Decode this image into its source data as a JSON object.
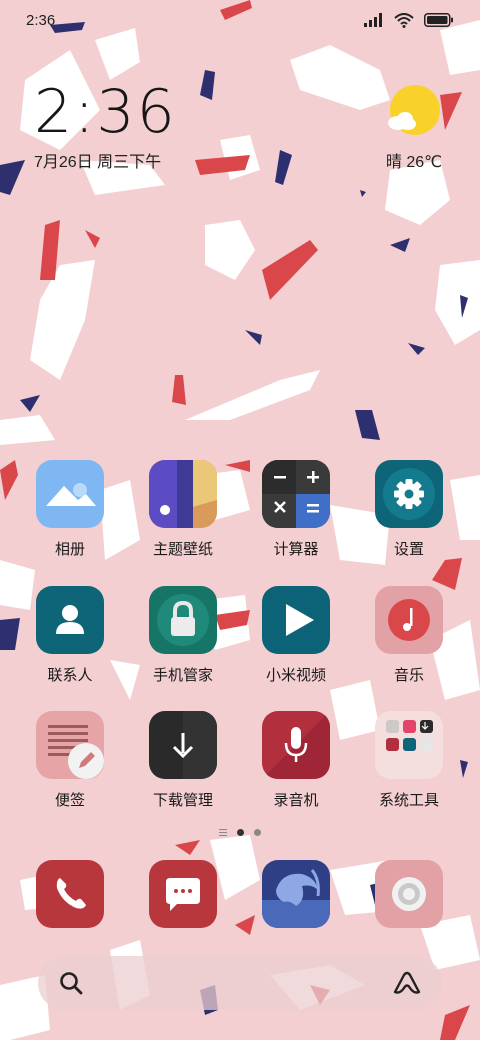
{
  "status_bar": {
    "time": "2:36",
    "battery_level": 1.0
  },
  "clock_widget": {
    "time": "2:36",
    "date": "7月26日 周三下午"
  },
  "weather_widget": {
    "text": "晴 26℃",
    "icon": "sun-cloud-icon"
  },
  "apps": [
    {
      "label": "相册",
      "icon": "gallery-icon"
    },
    {
      "label": "主题壁纸",
      "icon": "themes-icon"
    },
    {
      "label": "计算器",
      "icon": "calculator-icon"
    },
    {
      "label": "设置",
      "icon": "gear-icon"
    },
    {
      "label": "联系人",
      "icon": "contacts-icon"
    },
    {
      "label": "手机管家",
      "icon": "security-lock-icon"
    },
    {
      "label": "小米视频",
      "icon": "video-play-icon"
    },
    {
      "label": "音乐",
      "icon": "music-note-icon"
    },
    {
      "label": "便签",
      "icon": "notes-icon"
    },
    {
      "label": "下载管理",
      "icon": "download-icon"
    },
    {
      "label": "录音机",
      "icon": "microphone-icon"
    },
    {
      "label": "系统工具",
      "icon": "folder-icon"
    }
  ],
  "page_indicator": {
    "pages": 2,
    "current": 1
  },
  "dock": [
    {
      "icon": "phone-icon"
    },
    {
      "icon": "messages-icon"
    },
    {
      "icon": "browser-icon"
    },
    {
      "icon": "camera-icon"
    }
  ],
  "search_bar": {
    "left_icon": "search-icon",
    "right_icon": "assistant-icon"
  },
  "colors": {
    "wallpaper": "#f3cfd2",
    "confetti_red": "#d9474b",
    "confetti_navy": "#2e2f6e"
  }
}
